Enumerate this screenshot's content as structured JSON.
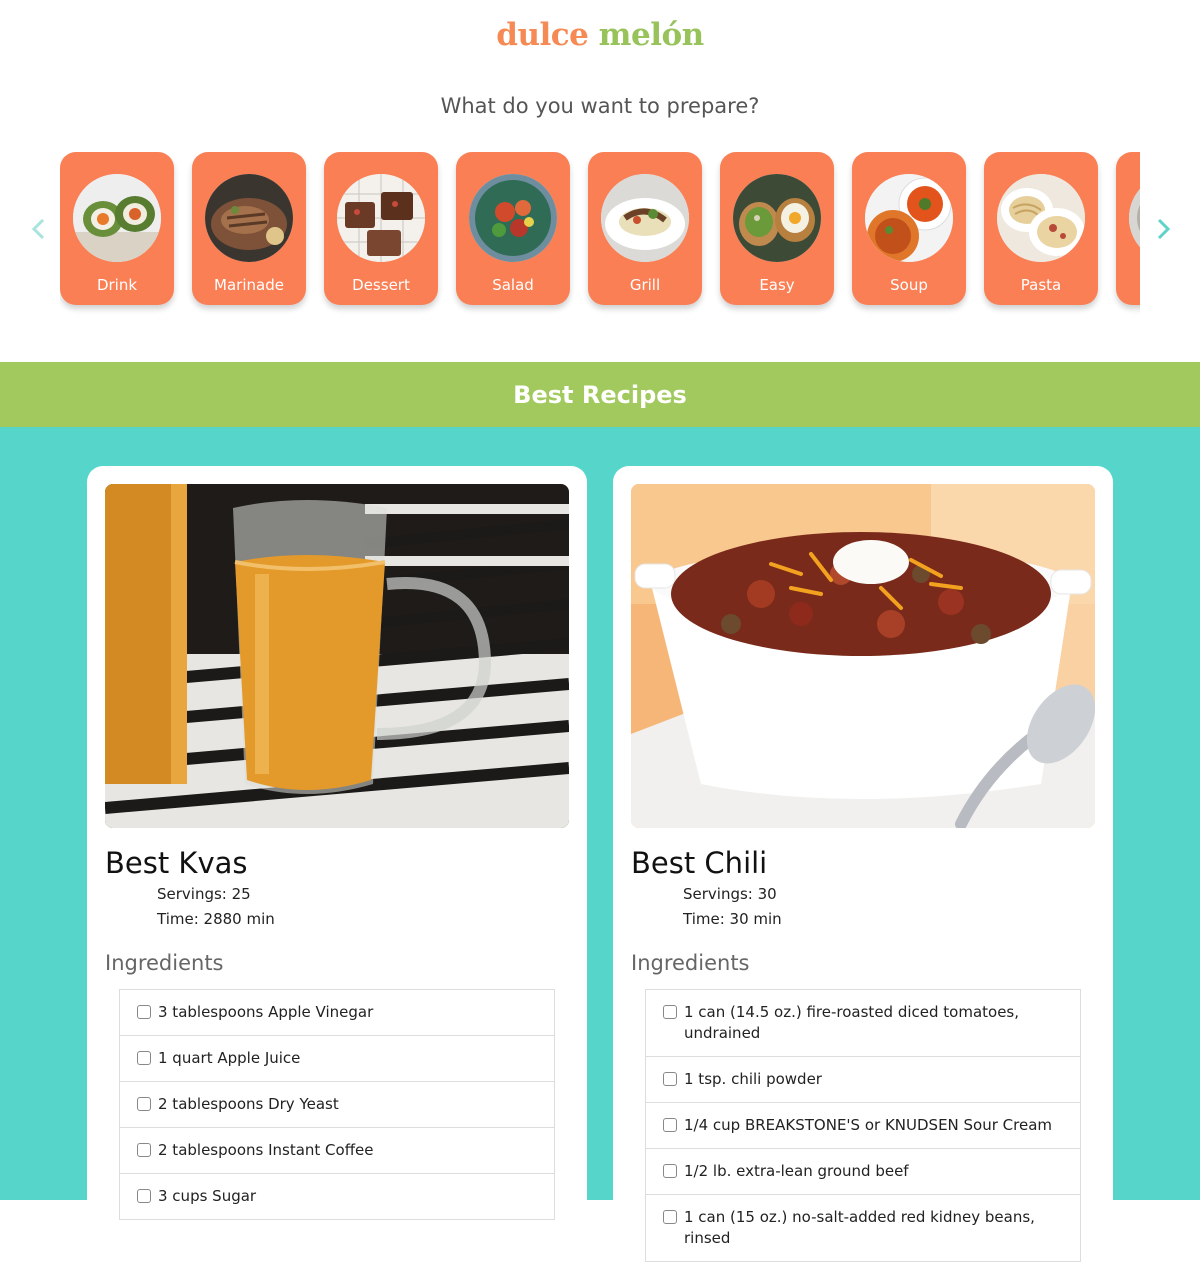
{
  "brand": {
    "word1": "dulce",
    "word2": "melón"
  },
  "question": "What do you want to prepare?",
  "categories": [
    {
      "label": "Drink",
      "icon": "drink-photo"
    },
    {
      "label": "Marinade",
      "icon": "marinade-photo"
    },
    {
      "label": "Dessert",
      "icon": "dessert-photo"
    },
    {
      "label": "Salad",
      "icon": "salad-photo"
    },
    {
      "label": "Grill",
      "icon": "grill-photo"
    },
    {
      "label": "Easy",
      "icon": "easy-photo"
    },
    {
      "label": "Soup",
      "icon": "soup-photo"
    },
    {
      "label": "Pasta",
      "icon": "pasta-photo"
    },
    {
      "label": "",
      "icon": "partial-photo"
    }
  ],
  "section_title": "Best Recipes",
  "recipes": [
    {
      "title": "Best Kvas",
      "servings": "Servings: 25",
      "time": "Time: 2880 min",
      "ingredients_heading": "Ingredients",
      "ingredients": [
        "3 tablespoons Apple Vinegar",
        "1 quart Apple Juice",
        "2 tablespoons Dry Yeast",
        "2 tablespoons Instant Coffee",
        "3 cups Sugar"
      ]
    },
    {
      "title": "Best Chili",
      "servings": "Servings: 30",
      "time": "Time: 30 min",
      "ingredients_heading": "Ingredients",
      "ingredients": [
        "1 can (14.5 oz.) fire-roasted diced tomatoes, undrained",
        "1 tsp. chili powder",
        "1/4 cup BREAKSTONE'S or KNUDSEN Sour Cream",
        "1/2 lb. extra-lean ground beef",
        "1 can (15 oz.) no-salt-added red kidney beans, rinsed"
      ]
    }
  ],
  "colors": {
    "category_bg": "#fa7f55",
    "band": "#a2c95e",
    "teal": "#56d6cb",
    "arrow": "#5fd3c8"
  }
}
